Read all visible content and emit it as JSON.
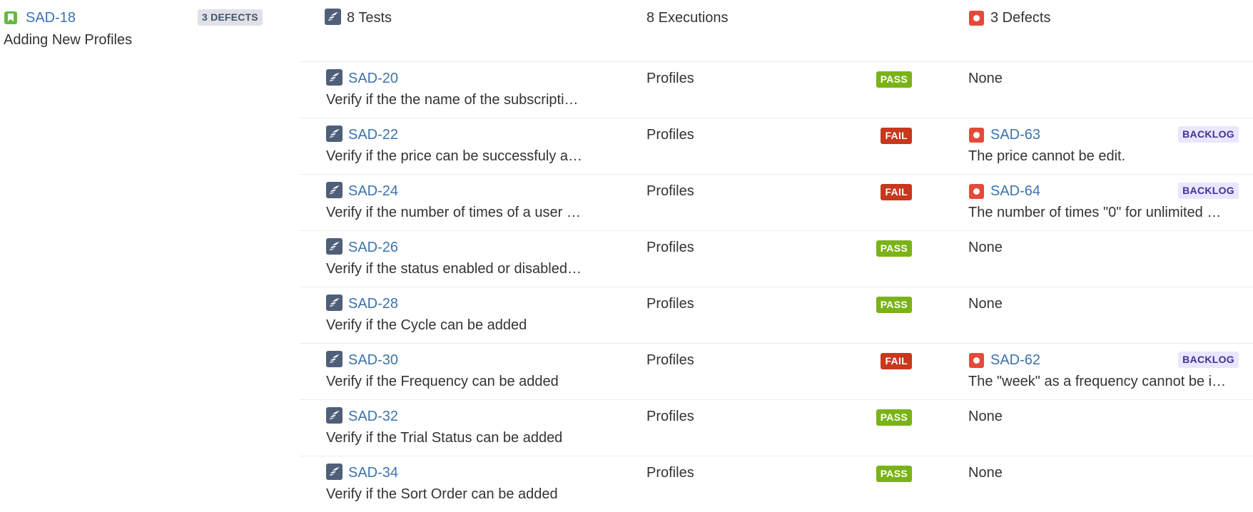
{
  "story": {
    "key": "SAD-18",
    "title": "Adding New Profiles",
    "defects_badge": "3 DEFECTS"
  },
  "summary": {
    "tests": "8 Tests",
    "executions": "8 Executions",
    "defects": "3 Defects"
  },
  "rows": [
    {
      "key": "SAD-20",
      "summary": "Verify if the the name of the subscripti…",
      "component": "Profiles",
      "status": "PASS",
      "defect": "None"
    },
    {
      "key": "SAD-22",
      "summary": "Verify if the price can be successfuly a…",
      "component": "Profiles",
      "status": "FAIL",
      "defect_key": "SAD-63",
      "defect_summary": "The price cannot be edit.",
      "defect_status": "BACKLOG"
    },
    {
      "key": "SAD-24",
      "summary": "Verify if the number of times of a user …",
      "component": "Profiles",
      "status": "FAIL",
      "defect_key": "SAD-64",
      "defect_summary": "The number of times \"0\" for unlimited …",
      "defect_status": "BACKLOG"
    },
    {
      "key": "SAD-26",
      "summary": "Verify if the status enabled or disabled…",
      "component": "Profiles",
      "status": "PASS",
      "defect": "None"
    },
    {
      "key": "SAD-28",
      "summary": "Verify if the Cycle can be added",
      "component": "Profiles",
      "status": "PASS",
      "defect": "None"
    },
    {
      "key": "SAD-30",
      "summary": "Verify if the Frequency can be added",
      "component": "Profiles",
      "status": "FAIL",
      "defect_key": "SAD-62",
      "defect_summary": "The \"week\" as a frequency cannot be i…",
      "defect_status": "BACKLOG"
    },
    {
      "key": "SAD-32",
      "summary": "Verify if the Trial Status can be added",
      "component": "Profiles",
      "status": "PASS",
      "defect": "None"
    },
    {
      "key": "SAD-34",
      "summary": "Verify if the Sort Order can be added",
      "component": "Profiles",
      "status": "PASS",
      "defect": "None"
    }
  ],
  "icons": {
    "story": "story-bookmark-icon",
    "test": "test-feather-icon",
    "bug": "bug-icon"
  },
  "colors": {
    "link": "#3b73af",
    "pass": "#7ab317",
    "fail": "#c9371d",
    "backlog_bg": "#eae6ff",
    "backlog_text": "#403294",
    "story_icon": "#65ba43",
    "bug_icon": "#e5493a",
    "test_icon": "#505f79"
  }
}
